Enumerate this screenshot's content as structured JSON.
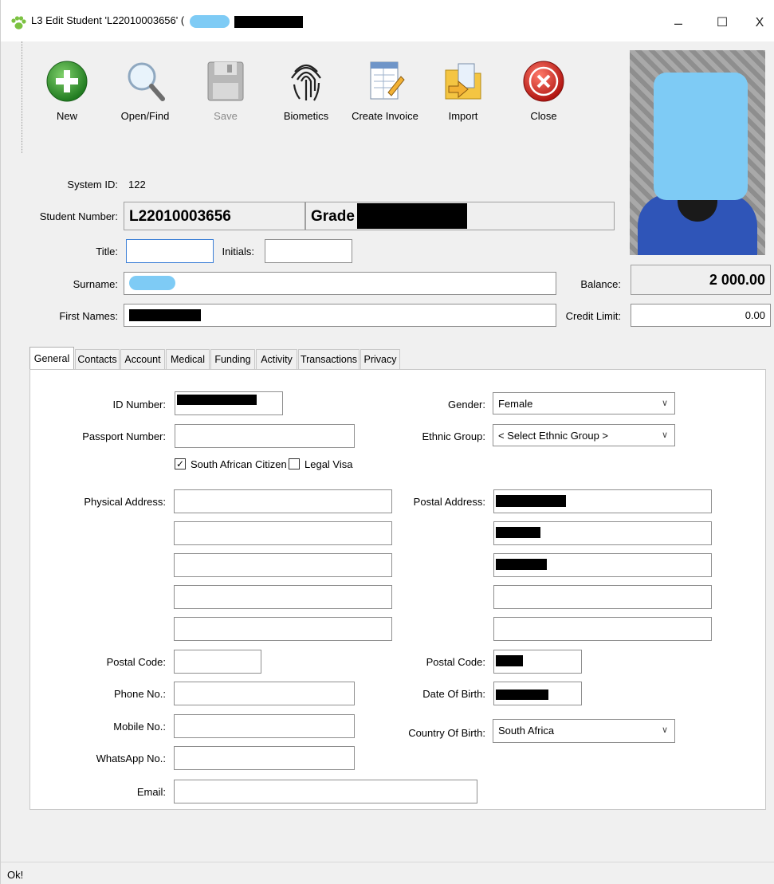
{
  "window": {
    "title": "L3 Edit Student 'L22010003656' (",
    "minimize": "–",
    "maximize": "☐",
    "close": "X"
  },
  "toolbar": {
    "new_label": "New",
    "open_label": "Open/Find",
    "save_label": "Save",
    "biometics_label": "Biometics",
    "invoice_label": "Create Invoice",
    "import_label": "Import",
    "close_label": "Close"
  },
  "student": {
    "system_id_label": "System ID:",
    "system_id": "122",
    "student_number_label": "Student Number:",
    "student_number": "L22010003656",
    "grade_label": "Grade",
    "title_label": "Title:",
    "title_value": "",
    "initials_label": "Initials:",
    "initials_value": "",
    "surname_label": "Surname:",
    "first_names_label": "First Names:",
    "balance_label": "Balance:",
    "balance": "2 000.00",
    "credit_limit_label": "Credit Limit:",
    "credit_limit": "0.00"
  },
  "tabs": [
    "General",
    "Contacts",
    "Account",
    "Medical",
    "Funding",
    "Activity",
    "Transactions",
    "Privacy"
  ],
  "general": {
    "id_number_label": "ID Number:",
    "passport_label": "Passport Number:",
    "passport_value": "",
    "sa_citizen_label": "South African Citizen",
    "sa_citizen_checked": "✓",
    "legal_visa_label": "Legal Visa",
    "physical_address_label": "Physical Address:",
    "postal_code_label": "Postal Code:",
    "phone_label": "Phone No.:",
    "mobile_label": "Mobile No.:",
    "whatsapp_label": "WhatsApp No.:",
    "email_label": "Email:",
    "gender_label": "Gender:",
    "gender_value": "Female",
    "ethnic_label": "Ethnic Group:",
    "ethnic_value": "< Select Ethnic Group >",
    "postal_address_label": "Postal Address:",
    "postal_code2_label": "Postal Code:",
    "dob_label": "Date Of Birth:",
    "country_label": "Country Of Birth:",
    "country_value": "South Africa",
    "dropdown_arrow": "∨"
  },
  "status": {
    "text": "Ok!"
  }
}
